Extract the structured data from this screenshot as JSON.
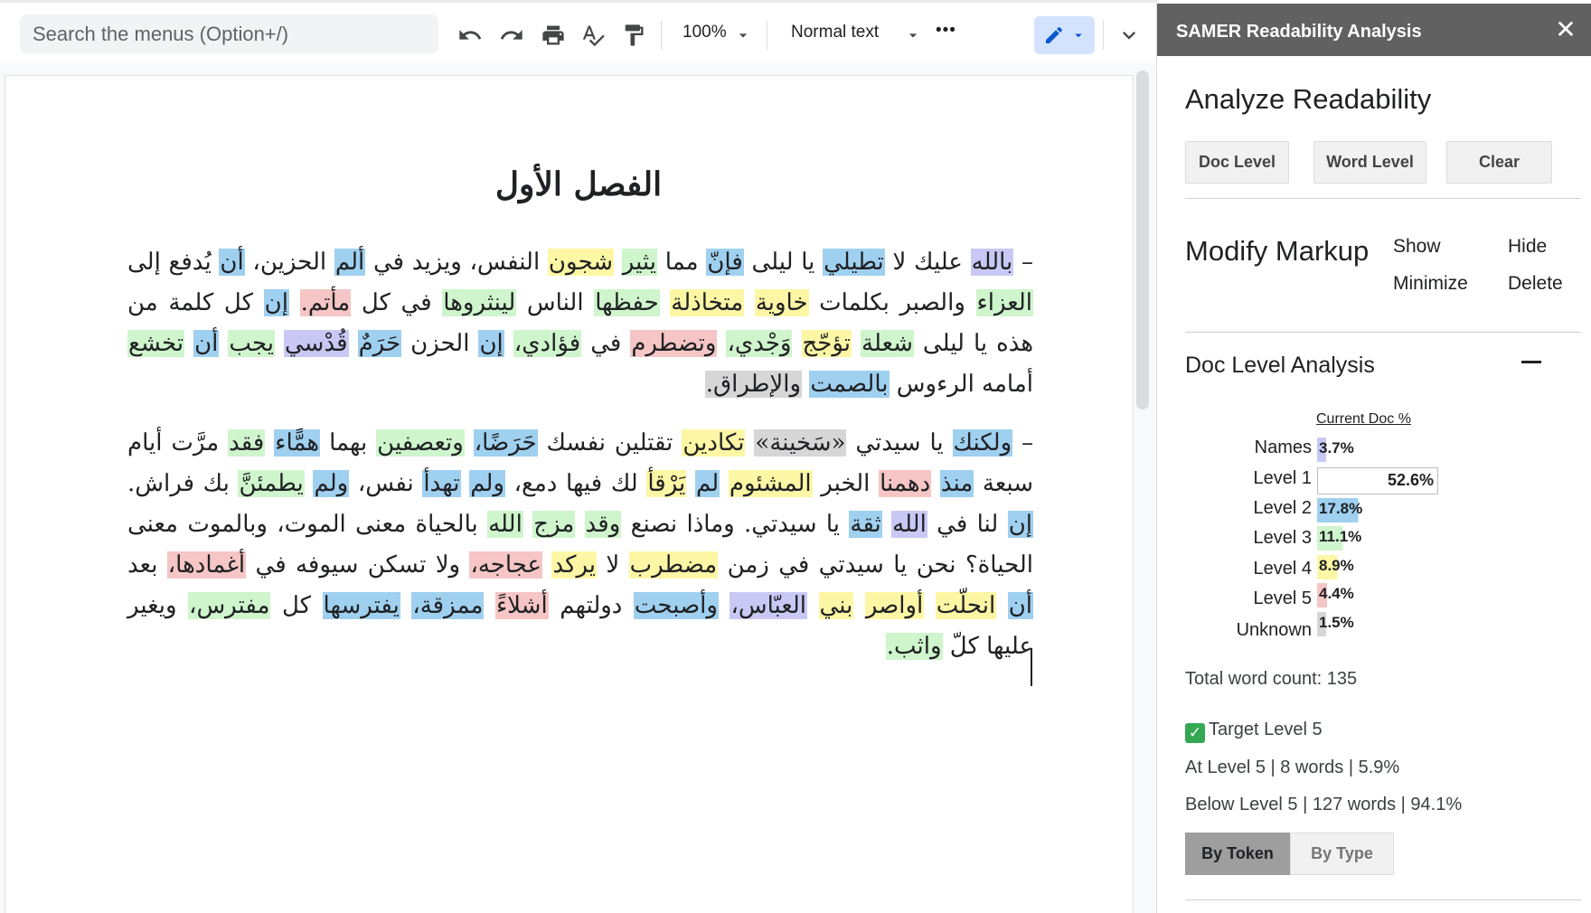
{
  "toolbar": {
    "search_placeholder": "Search the menus (Option+/)",
    "zoom": "100%",
    "style": "Normal text",
    "more": "•••",
    "icons": [
      "undo-icon",
      "redo-icon",
      "print-icon",
      "spellcheck-icon",
      "paint-format-icon",
      "chevron-down-icon",
      "more-icon",
      "pencil-icon",
      "chevron-down-icon"
    ]
  },
  "document": {
    "title": "الفصل الأول",
    "paragraphs": [
      [
        {
          "t": "– "
        },
        {
          "t": "بالله",
          "c": "names"
        },
        {
          "t": " عليك لا "
        },
        {
          "t": "تطيلي",
          "c": "l2"
        },
        {
          "t": " يا ليلى "
        },
        {
          "t": "فإنّ",
          "c": "l2"
        },
        {
          "t": " مما "
        },
        {
          "t": "يثير",
          "c": "l3"
        },
        {
          "t": " "
        },
        {
          "t": "شجون",
          "c": "l4"
        },
        {
          "t": " النفس، ويزيد في "
        },
        {
          "t": "ألم",
          "c": "l2"
        },
        {
          "t": " الحزين، "
        },
        {
          "t": "أن",
          "c": "l2"
        },
        {
          "t": " يُدفع إلى "
        },
        {
          "t": "العزاء",
          "c": "l3"
        },
        {
          "t": " والصبر بكلمات "
        },
        {
          "t": "خاوية",
          "c": "l4"
        },
        {
          "t": " "
        },
        {
          "t": "متخاذلة",
          "c": "l4"
        },
        {
          "t": " "
        },
        {
          "t": "حفظها",
          "c": "l3"
        },
        {
          "t": " الناس "
        },
        {
          "t": "لينثروها",
          "c": "l3"
        },
        {
          "t": " في كل "
        },
        {
          "t": "مأتم.",
          "c": "l5"
        },
        {
          "t": " "
        },
        {
          "t": "إن",
          "c": "l2"
        },
        {
          "t": " كل كلمة من هذه يا ليلى "
        },
        {
          "t": "شعلة",
          "c": "l3"
        },
        {
          "t": " "
        },
        {
          "t": "تؤجّج",
          "c": "l4"
        },
        {
          "t": " "
        },
        {
          "t": "وَجْدي،",
          "c": "l3"
        },
        {
          "t": " "
        },
        {
          "t": "وتضطرم",
          "c": "l5"
        },
        {
          "t": " في "
        },
        {
          "t": "فؤادي،",
          "c": "l3"
        },
        {
          "t": " "
        },
        {
          "t": "إن",
          "c": "l2"
        },
        {
          "t": " الحزن "
        },
        {
          "t": "حَرَمٌ",
          "c": "l2"
        },
        {
          "t": " "
        },
        {
          "t": "قُدْسي",
          "c": "names"
        },
        {
          "t": " "
        },
        {
          "t": "يجب",
          "c": "l3"
        },
        {
          "t": " "
        },
        {
          "t": "أن",
          "c": "l2"
        },
        {
          "t": " "
        },
        {
          "t": "تخشع",
          "c": "l3"
        },
        {
          "t": " أمامه الرءوس "
        },
        {
          "t": "بالصمت",
          "c": "l2"
        },
        {
          "t": " "
        },
        {
          "t": "والإطراق.",
          "c": "unk"
        }
      ],
      [
        {
          "t": "– "
        },
        {
          "t": "ولكنك",
          "c": "l2"
        },
        {
          "t": " يا سيدتي "
        },
        {
          "t": "«سَخينة»",
          "c": "unk"
        },
        {
          "t": " "
        },
        {
          "t": "تكادين",
          "c": "l4"
        },
        {
          "t": " تقتلين نفسك "
        },
        {
          "t": "حَرَضًا،",
          "c": "l2"
        },
        {
          "t": " "
        },
        {
          "t": "وتعصفين",
          "c": "l3"
        },
        {
          "t": " بهما "
        },
        {
          "t": "همًّاء",
          "c": "l2"
        },
        {
          "t": " "
        },
        {
          "t": "فقد",
          "c": "l3"
        },
        {
          "t": " مرَّت أيام سبعة "
        },
        {
          "t": "منذ",
          "c": "l2"
        },
        {
          "t": " "
        },
        {
          "t": "دهمنا",
          "c": "l5"
        },
        {
          "t": " الخبر "
        },
        {
          "t": "المشئوم",
          "c": "l4"
        },
        {
          "t": " "
        },
        {
          "t": "لم",
          "c": "l2"
        },
        {
          "t": " "
        },
        {
          "t": "يَرْقأ",
          "c": "l4"
        },
        {
          "t": " لك فيها دمع، "
        },
        {
          "t": "ولم",
          "c": "l2"
        },
        {
          "t": " "
        },
        {
          "t": "تهدأ",
          "c": "l2"
        },
        {
          "t": " نفس، "
        },
        {
          "t": "ولم",
          "c": "l2"
        },
        {
          "t": " "
        },
        {
          "t": "يطمئنَّ",
          "c": "l3"
        },
        {
          "t": " بك فراش. "
        },
        {
          "t": "إن",
          "c": "l2"
        },
        {
          "t": " لنا في "
        },
        {
          "t": "الله",
          "c": "names"
        },
        {
          "t": " "
        },
        {
          "t": "ثقة",
          "c": "l2"
        },
        {
          "t": " يا سيدتي. وماذا نصنع "
        },
        {
          "t": "وقد",
          "c": "l3"
        },
        {
          "t": " "
        },
        {
          "t": "مزج",
          "c": "l3"
        },
        {
          "t": " "
        },
        {
          "t": "الله",
          "c": "l3"
        },
        {
          "t": " بالحياة معنى الموت، وبالموت معنى الحياة؟ نحن يا سيدتي في زمن "
        },
        {
          "t": "مضطرب",
          "c": "l4"
        },
        {
          "t": " لا "
        },
        {
          "t": "يركد",
          "c": "l4"
        },
        {
          "t": " "
        },
        {
          "t": "عجاجه،",
          "c": "l5"
        },
        {
          "t": " ولا تسكن سيوفه في "
        },
        {
          "t": "أغمادها،",
          "c": "l5"
        },
        {
          "t": " بعد "
        },
        {
          "t": "أن",
          "c": "l2"
        },
        {
          "t": " "
        },
        {
          "t": "انحلّت",
          "c": "l4"
        },
        {
          "t": " "
        },
        {
          "t": "أواصر",
          "c": "l4"
        },
        {
          "t": " "
        },
        {
          "t": "بني",
          "c": "l4"
        },
        {
          "t": " "
        },
        {
          "t": "العبّاس،",
          "c": "names"
        },
        {
          "t": " "
        },
        {
          "t": "وأصبحت",
          "c": "l2"
        },
        {
          "t": " دولتهم "
        },
        {
          "t": "أشلاءً",
          "c": "l5"
        },
        {
          "t": " "
        },
        {
          "t": "ممزقة،",
          "c": "l2"
        },
        {
          "t": " "
        },
        {
          "t": "يفترسها",
          "c": "l2"
        },
        {
          "t": " كل "
        },
        {
          "t": "مفترس،",
          "c": "l3"
        },
        {
          "t": " ويغير عليها كلّ "
        },
        {
          "t": "واثب.",
          "c": "l3"
        }
      ]
    ]
  },
  "sidebar": {
    "title": "SAMER Readability Analysis",
    "close": "✕",
    "analyze_title": "Analyze Readability",
    "buttons": {
      "doc_level": "Doc Level",
      "word_level": "Word Level",
      "clear": "Clear"
    },
    "modify_title": "Modify Markup",
    "markup_links": {
      "show": "Show",
      "hide": "Hide",
      "minimize": "Minimize",
      "delete": "Delete"
    },
    "doc_level_title": "Doc Level Analysis",
    "current_doc_header": "Current Doc %",
    "levels": [
      {
        "label": "Names",
        "value": "3.7%",
        "pct": 3.7,
        "color": "#c9c8f5"
      },
      {
        "label": "Level 1",
        "value": "52.6%",
        "pct": 52.6,
        "color": "#ffffff"
      },
      {
        "label": "Level 2",
        "value": "17.8%",
        "pct": 17.8,
        "color": "#9fd0f0"
      },
      {
        "label": "Level 3",
        "value": "11.1%",
        "pct": 11.1,
        "color": "#cff5cc"
      },
      {
        "label": "Level 4",
        "value": "8.9%",
        "pct": 8.9,
        "color": "#fdf7a5"
      },
      {
        "label": "Level 5",
        "value": "4.4%",
        "pct": 4.4,
        "color": "#f5c6c5"
      },
      {
        "label": "Unknown",
        "value": "1.5%",
        "pct": 1.5,
        "color": "#d6d6d6"
      }
    ],
    "total_word_count": "Total word count: 135",
    "target_level": "Target Level 5",
    "at_level": "At Level 5 | 8 words | 5.9%",
    "below_level": "Below Level 5 | 127 words | 94.1%",
    "by_token": "By Token",
    "by_type": "By Type"
  }
}
